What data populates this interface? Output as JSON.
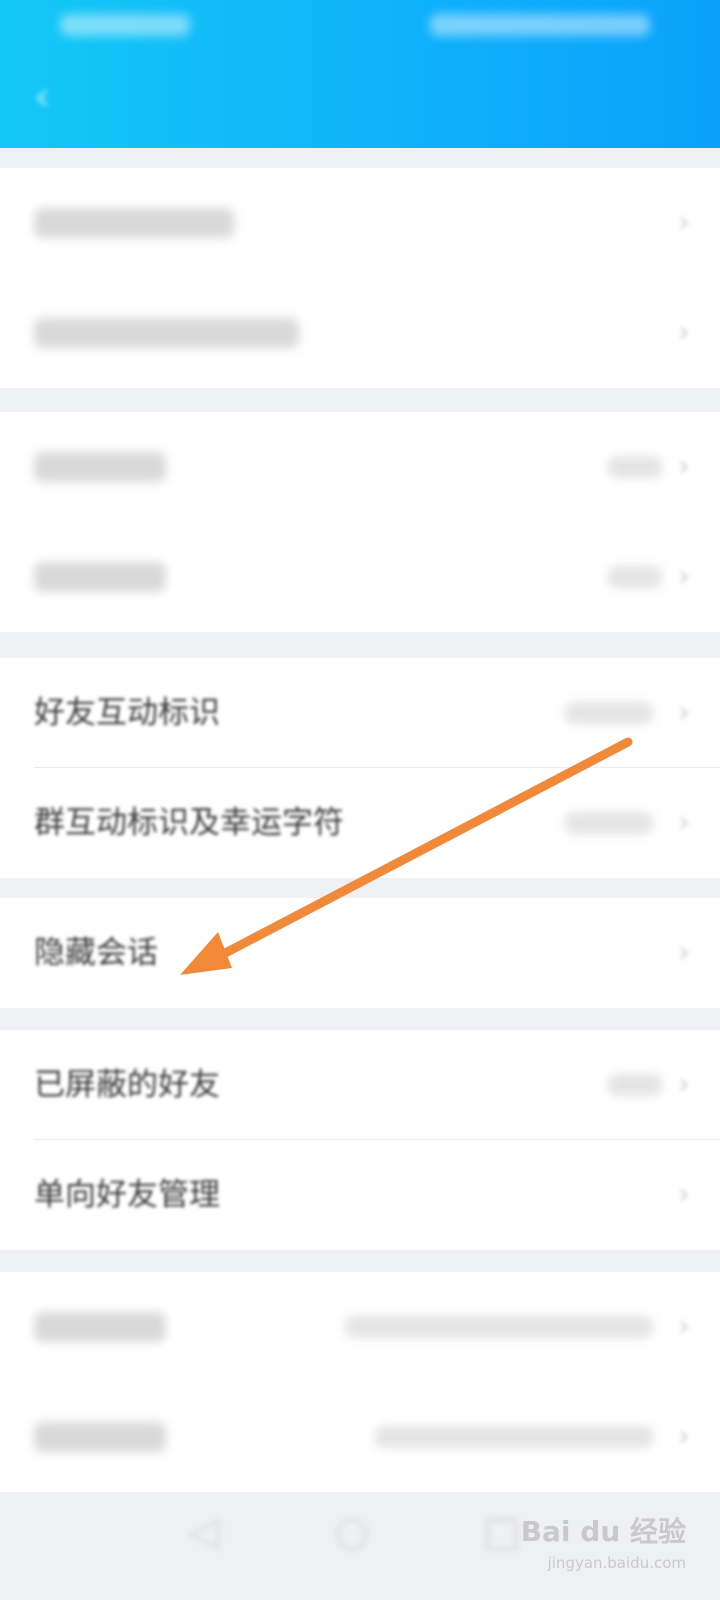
{
  "header": {
    "title": "",
    "back_icon": "back-arrow-icon"
  },
  "sections": [
    {
      "rows": [
        {
          "label": "",
          "value": "",
          "blurred": true
        },
        {
          "label": "",
          "value": "",
          "blurred": true
        }
      ]
    },
    {
      "rows": [
        {
          "label": "",
          "value": "",
          "blurred": true
        },
        {
          "label": "",
          "value": "",
          "blurred": true
        }
      ]
    },
    {
      "rows": [
        {
          "label": "好友互动标识",
          "value": "",
          "blurred": false
        },
        {
          "label": "群互动标识及幸运字符",
          "value": "",
          "blurred": false
        }
      ]
    },
    {
      "rows": [
        {
          "label": "隐藏会话",
          "value": "",
          "blurred": false
        }
      ]
    },
    {
      "rows": [
        {
          "label": "已屏蔽的好友",
          "value": "",
          "blurred": false
        },
        {
          "label": "单向好友管理",
          "value": "",
          "blurred": false
        }
      ]
    },
    {
      "rows": [
        {
          "label": "",
          "value": "",
          "blurred": true
        },
        {
          "label": "",
          "value": "",
          "blurred": true
        }
      ]
    }
  ],
  "watermark": {
    "brand": "Bai du 经验",
    "url": "jingyan.baidu.com"
  },
  "annotation": {
    "arrow_color": "#f08a3a"
  },
  "colors": {
    "header_start": "#14c8f5",
    "header_end": "#0aa2fb",
    "background": "#eef0f4"
  }
}
